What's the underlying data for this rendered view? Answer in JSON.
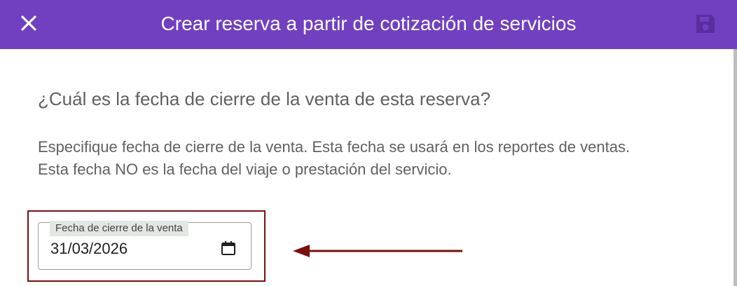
{
  "header": {
    "title": "Crear reserva a partir de cotización de servicios",
    "close_icon": "close-icon",
    "save_icon": "save-icon",
    "color": "#7040c0"
  },
  "content": {
    "question": "¿Cuál es la fecha de cierre de la venta de esta reserva?",
    "description_line1": "Especifique fecha de cierre de la venta. Esta fecha se usará en los reportes de ventas.",
    "description_line2": "Esta fecha NO es la fecha del viaje o prestación del servicio."
  },
  "date_field": {
    "label": "Fecha de cierre de la venta",
    "value": "31/03/2026",
    "icon": "calendar-icon"
  },
  "annotation": {
    "color": "#7a0f0f",
    "arrow_icon": "arrow-left-icon"
  }
}
